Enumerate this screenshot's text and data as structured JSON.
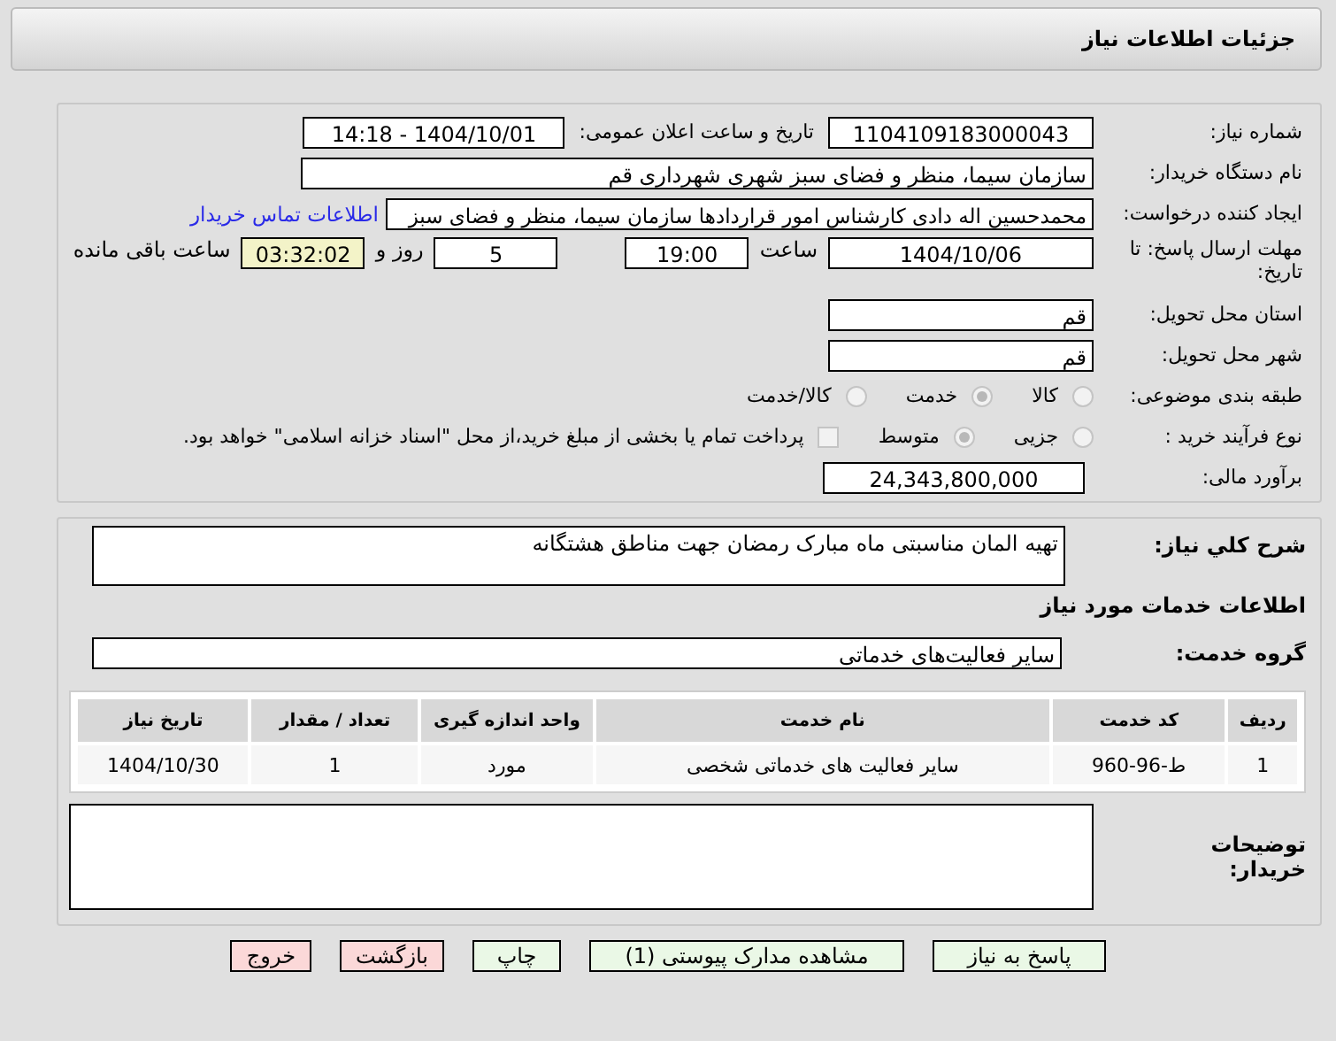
{
  "header": {
    "title": "جزئیات اطلاعات نیاز"
  },
  "details": {
    "need_number_label": "شماره نیاز:",
    "need_number": "1104109183000043",
    "announce_label": "تاریخ و ساعت اعلان عمومی:",
    "announce_value": "1404/10/01 - 14:18",
    "buyer_label": "نام دستگاه خریدار:",
    "buyer": "سازمان سیما، منظر و فضای سبز شهری شهرداری قم",
    "creator_label": "ایجاد کننده درخواست:",
    "creator": "محمدحسین اله دادی کارشناس امور قراردادها سازمان سیما، منظر و فضای سبز",
    "contact_link": "اطلاعات تماس خریدار",
    "deadline_label": "مهلت ارسال پاسخ: تا تاریخ:",
    "deadline_date": "1404/10/06",
    "time_label": "ساعت",
    "deadline_time": "19:00",
    "days": "5",
    "days_label": "روز و",
    "remaining": "03:32:02",
    "remaining_label": "ساعت باقی مانده",
    "province_label": "استان محل تحویل:",
    "province": "قم",
    "city_label": "شهر محل تحویل:",
    "city": "قم",
    "category_label": "طبقه بندی موضوعی:",
    "category_options": [
      {
        "label": "کالا",
        "selected": false
      },
      {
        "label": "خدمت",
        "selected": true
      },
      {
        "label": "کالا/خدمت",
        "selected": false
      }
    ],
    "process_label": "نوع فرآیند خرید :",
    "process_options": [
      {
        "label": "جزیی",
        "selected": false
      },
      {
        "label": "متوسط",
        "selected": true
      }
    ],
    "treasury": {
      "checked": false,
      "label": "پرداخت تمام یا بخشی از مبلغ خرید،از محل \"اسناد خزانه اسلامی\" خواهد بود."
    },
    "budget_label": "برآورد مالی:",
    "budget": "24,343,800,000"
  },
  "services": {
    "description_label": "شرح کلي نياز:",
    "description": "تهیه المان مناسبتی ماه مبارک رمضان جهت مناطق هشتگانه",
    "section_title": "اطلاعات خدمات مورد نیاز",
    "group_label": "گروه خدمت:",
    "group": "سایر فعالیت‌های خدماتی",
    "table": {
      "columns": [
        "ردیف",
        "کد خدمت",
        "نام خدمت",
        "واحد اندازه گیری",
        "تعداد / مقدار",
        "تاریخ نیاز"
      ],
      "rows": [
        [
          "1",
          "ط-96-960",
          "سایر فعالیت های خدماتی شخصی",
          "مورد",
          "1",
          "1404/10/30"
        ]
      ]
    },
    "notes_label": "توضیحات خریدار:"
  },
  "buttons": [
    {
      "label": "پاسخ به نیاز",
      "kind": "action"
    },
    {
      "label": "مشاهده مدارک پیوستی (1)",
      "kind": "action"
    },
    {
      "label": "چاپ",
      "kind": "action"
    },
    {
      "label": "بازگشت",
      "kind": "exit"
    },
    {
      "label": "خروج",
      "kind": "exit"
    }
  ]
}
